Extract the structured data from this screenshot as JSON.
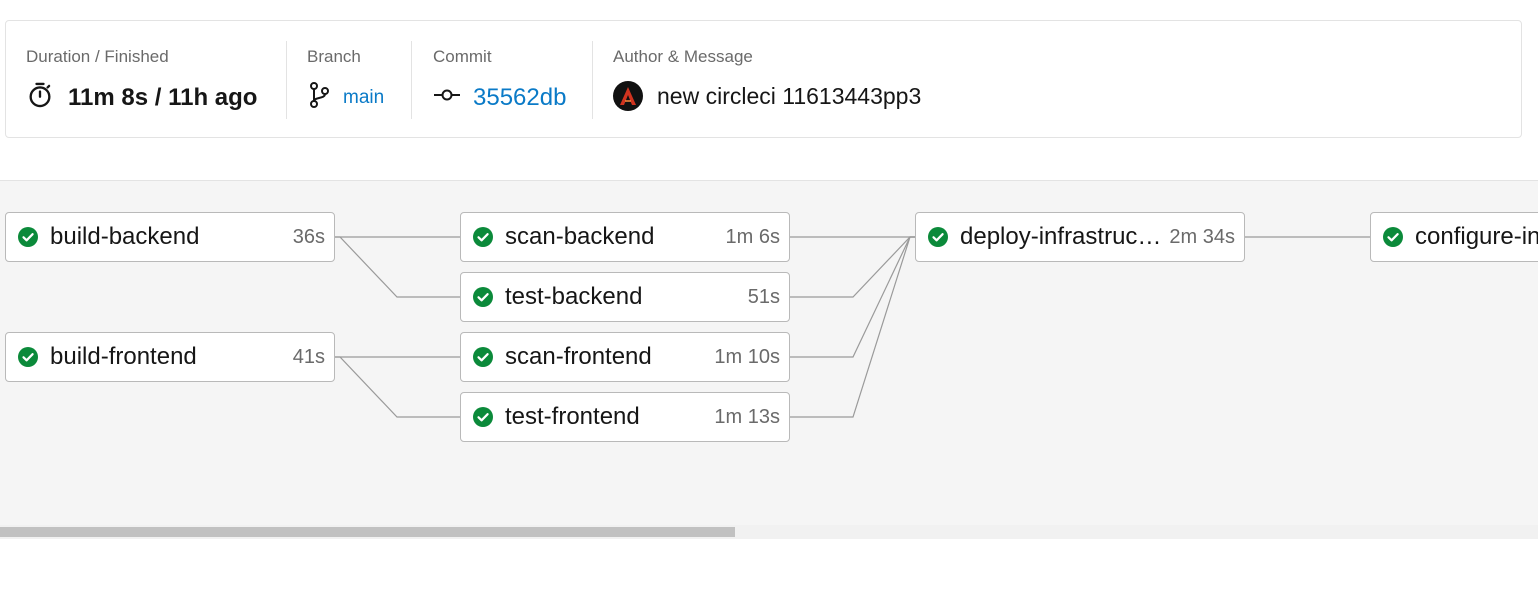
{
  "summary": {
    "duration": {
      "label": "Duration / Finished",
      "value": "11m 8s / 11h ago",
      "icon": "stopwatch-icon"
    },
    "branch": {
      "label": "Branch",
      "value": "main",
      "icon": "branch-icon"
    },
    "commit": {
      "label": "Commit",
      "value": "35562db",
      "icon": "commit-icon"
    },
    "author": {
      "label": "Author & Message",
      "message": "new circleci 11613443pp3",
      "icon": "avatar"
    }
  },
  "workflow": {
    "jobs": [
      {
        "id": "build-backend",
        "name": "build-backend",
        "time": "36s",
        "status": "success"
      },
      {
        "id": "build-frontend",
        "name": "build-frontend",
        "time": "41s",
        "status": "success"
      },
      {
        "id": "scan-backend",
        "name": "scan-backend",
        "time": "1m 6s",
        "status": "success"
      },
      {
        "id": "test-backend",
        "name": "test-backend",
        "time": "51s",
        "status": "success"
      },
      {
        "id": "scan-frontend",
        "name": "scan-frontend",
        "time": "1m 10s",
        "status": "success"
      },
      {
        "id": "test-frontend",
        "name": "test-frontend",
        "time": "1m 13s",
        "status": "success"
      },
      {
        "id": "deploy-infrastructure",
        "name": "deploy-infrastructure",
        "time": "2m 34s",
        "status": "success"
      },
      {
        "id": "configure-infrastructure",
        "name": "configure-infrastructure",
        "time": "",
        "status": "success"
      }
    ],
    "dependencies": [
      [
        "build-backend",
        "scan-backend"
      ],
      [
        "build-backend",
        "test-backend"
      ],
      [
        "build-frontend",
        "scan-frontend"
      ],
      [
        "build-frontend",
        "test-frontend"
      ],
      [
        "scan-backend",
        "deploy-infrastructure"
      ],
      [
        "test-backend",
        "deploy-infrastructure"
      ],
      [
        "scan-frontend",
        "deploy-infrastructure"
      ],
      [
        "test-frontend",
        "deploy-infrastructure"
      ],
      [
        "deploy-infrastructure",
        "configure-infrastructure"
      ]
    ]
  },
  "colors": {
    "success": "#0b8a3a",
    "link": "#0a7ac7",
    "edge": "#9a9a9a"
  }
}
